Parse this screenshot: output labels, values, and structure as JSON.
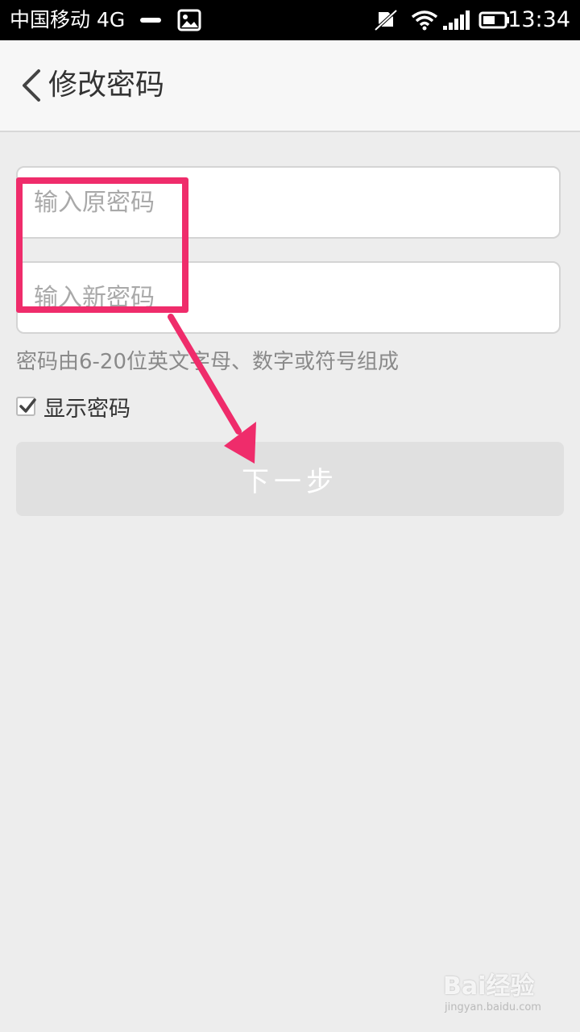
{
  "status_bar": {
    "carrier": "中国移动 4G",
    "time": "13:34",
    "icons": [
      "minus-icon",
      "image-icon",
      "mute-icon",
      "wifi-icon",
      "signal-icon",
      "battery-icon"
    ]
  },
  "header": {
    "back_icon": "chevron-left-icon",
    "title": "修改密码"
  },
  "form": {
    "old_password_placeholder": "输入原密码",
    "new_password_placeholder": "输入新密码",
    "hint": "密码由6-20位英文字母、数字或符号组成",
    "show_password_label": "显示密码",
    "show_password_checked": true,
    "next_button_label": "下一步"
  },
  "colors": {
    "annotation": "#ef2c6b",
    "background": "#ededed",
    "button_disabled": "#e0e0e0"
  },
  "watermark": {
    "brand": "Bai经验",
    "url": "jingyan.baidu.com"
  }
}
